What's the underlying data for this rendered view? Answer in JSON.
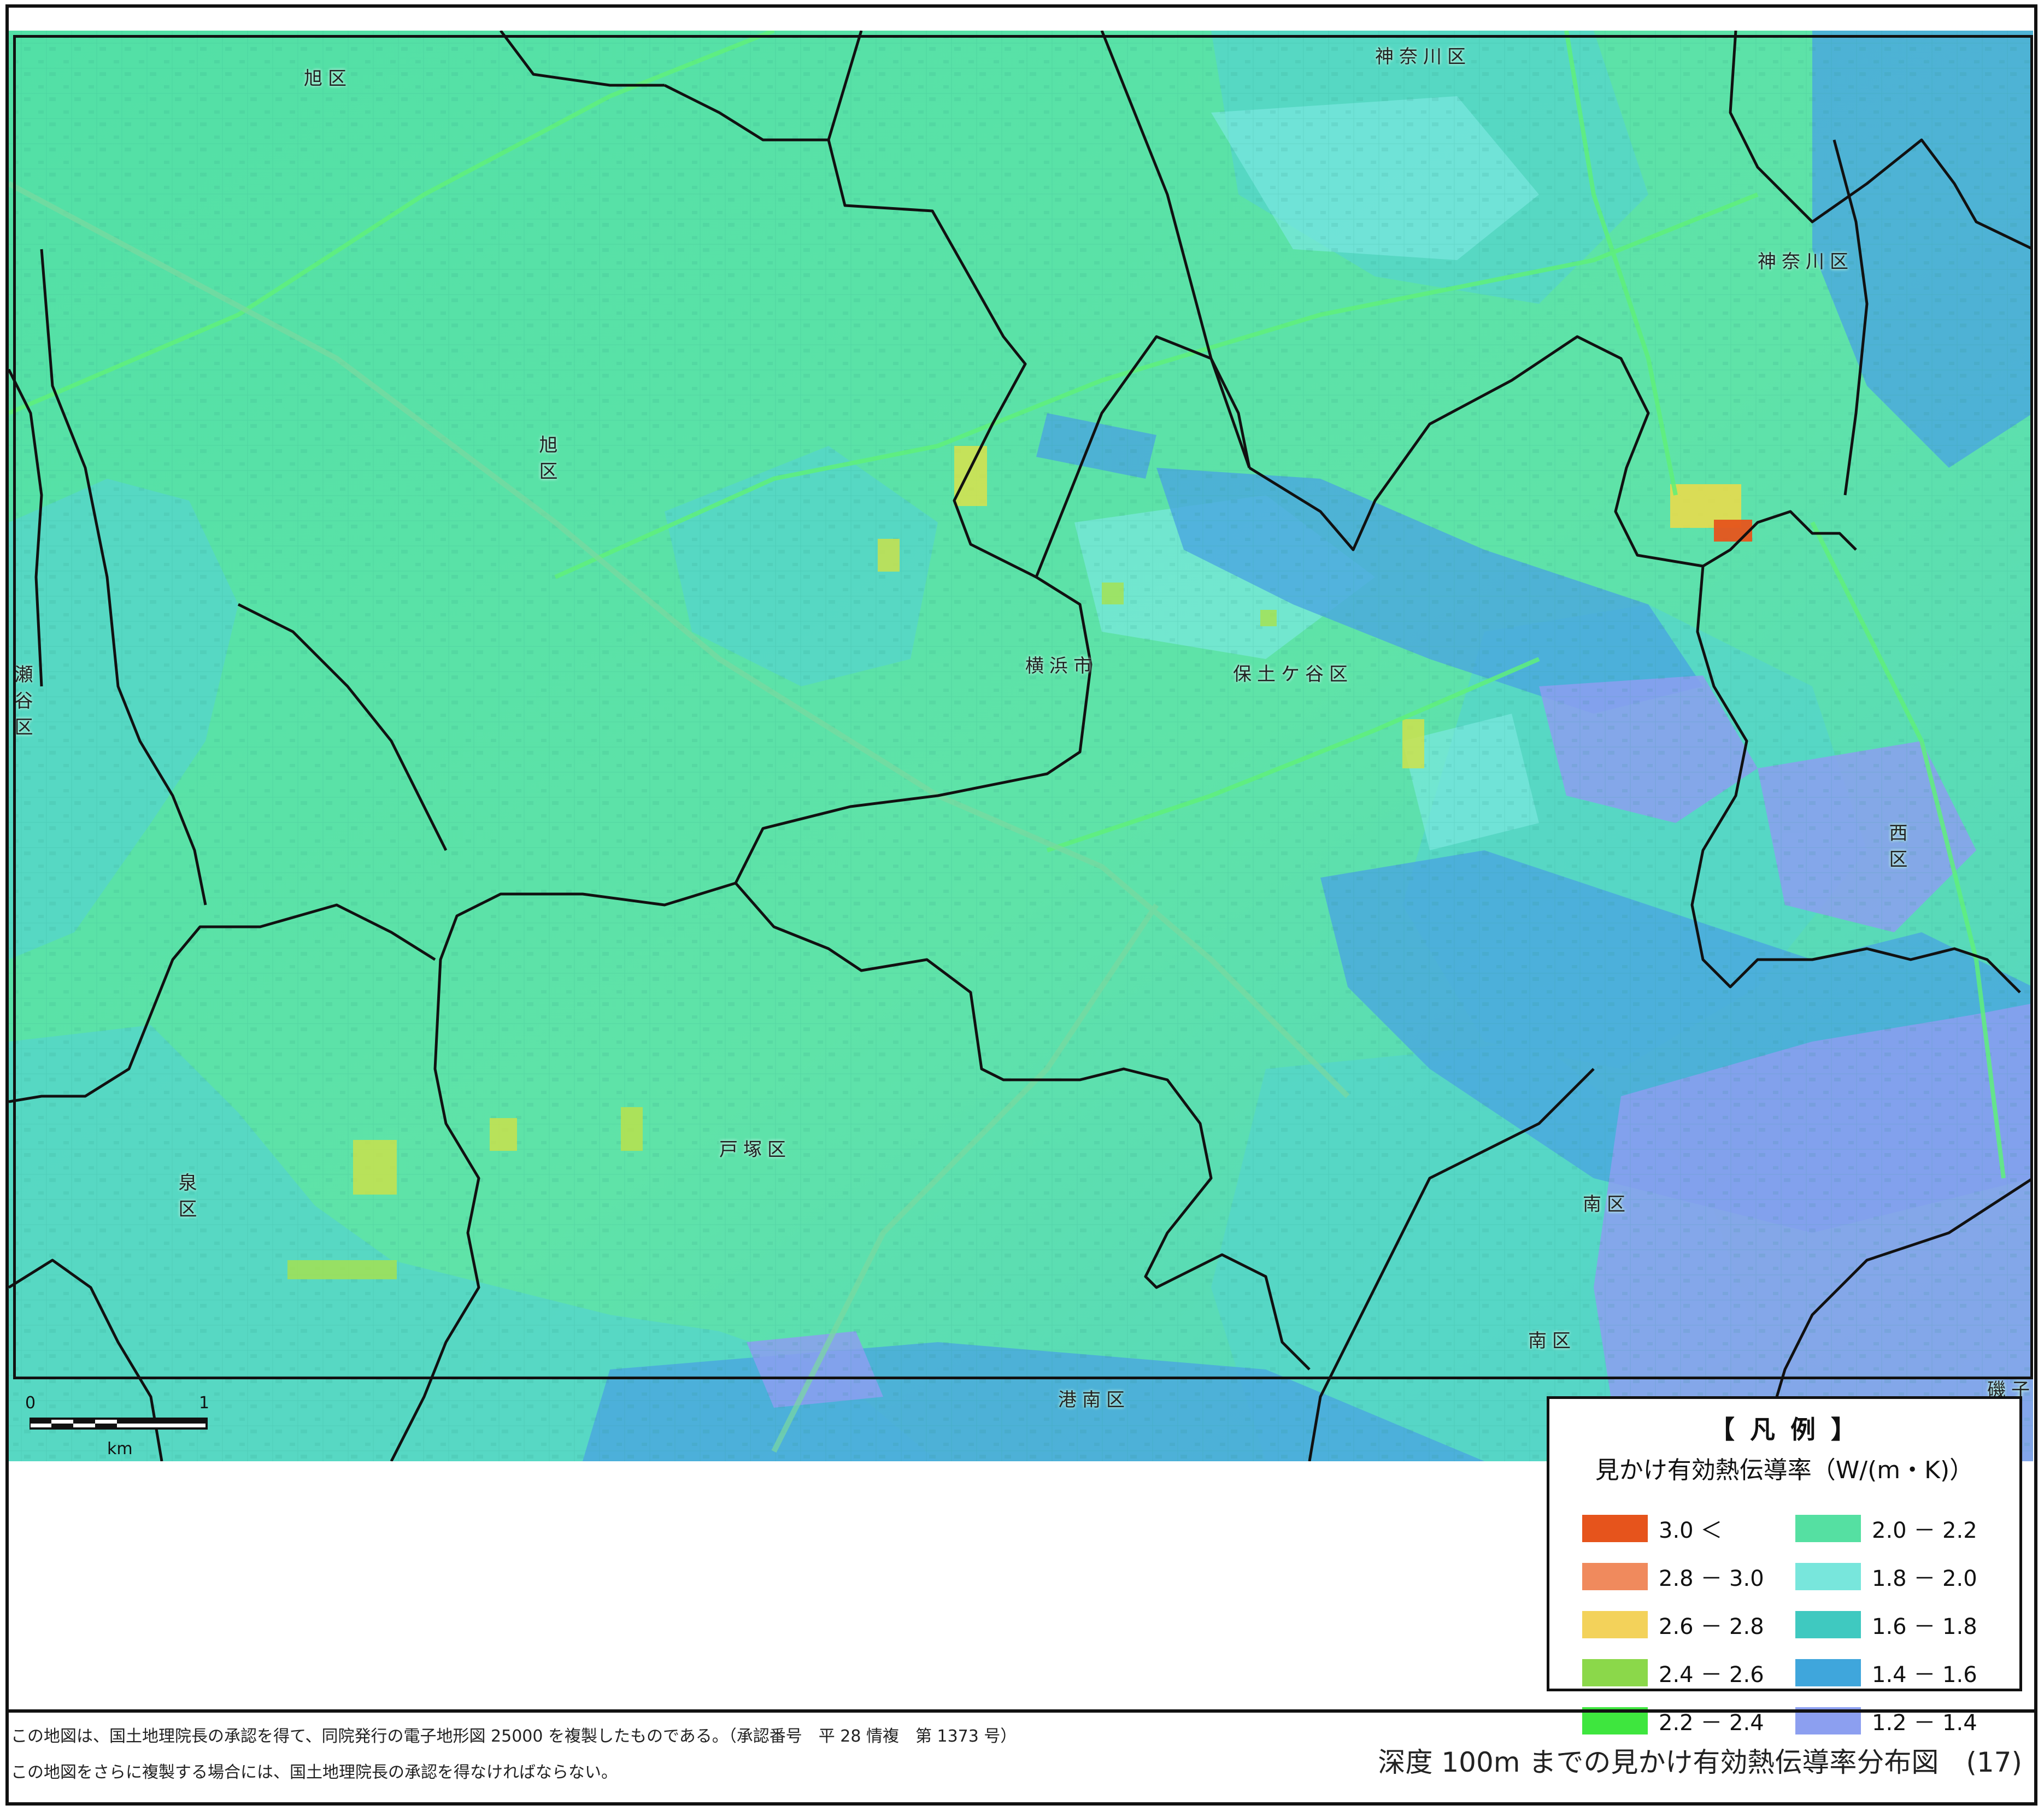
{
  "map": {
    "place_labels": [
      {
        "id": "asahi-ku-top",
        "text": "旭区"
      },
      {
        "id": "asahi-ku-mid",
        "text": "旭区"
      },
      {
        "id": "kanagawa-ku-top",
        "text": "神奈川区"
      },
      {
        "id": "kanagawa-ku-right",
        "text": "神奈川区"
      },
      {
        "id": "yokohama-shi",
        "text": "横浜市"
      },
      {
        "id": "hodogaya-ku",
        "text": "保土ケ谷区"
      },
      {
        "id": "seya-ku",
        "text": "瀬谷区"
      },
      {
        "id": "nishi-ku",
        "text": "西区"
      },
      {
        "id": "izumi-ku",
        "text": "泉区"
      },
      {
        "id": "totsuka-ku",
        "text": "戸塚区"
      },
      {
        "id": "minami-ku-1",
        "text": "南区"
      },
      {
        "id": "minami-ku-2",
        "text": "南区"
      },
      {
        "id": "konan-ku",
        "text": "港南区"
      },
      {
        "id": "isogo-ku",
        "text": "磯子区"
      }
    ],
    "colors": {
      "base_green": "#4fe1a5",
      "teal": "#57d8cc",
      "light_cyan": "#78e6dc",
      "blue": "#4aa6e0",
      "purple_blue": "#8c9ff0",
      "yellow": "#f3d25a",
      "lime": "#8bd84a",
      "orange": "#f08a5d",
      "red": "#e6541c"
    }
  },
  "scale": {
    "label_zero": "0",
    "label_one": "1",
    "unit": "km"
  },
  "legend": {
    "title": "【 凡 例 】",
    "subtitle": "見かけ有効熱伝導率（W/(m・K)）",
    "items": [
      {
        "label": "3.0 ＜",
        "color": "#e6541c"
      },
      {
        "label": "2.0 － 2.2",
        "color": "#55e0a2"
      },
      {
        "label": "2.8 － 3.0",
        "color": "#f08a5d"
      },
      {
        "label": "1.8 － 2.0",
        "color": "#78e6dc"
      },
      {
        "label": "2.6 － 2.8",
        "color": "#f3d25a"
      },
      {
        "label": "1.6 － 1.8",
        "color": "#3fc9c0"
      },
      {
        "label": "2.4 － 2.6",
        "color": "#8bd84a"
      },
      {
        "label": "1.4 － 1.6",
        "color": "#3fa6dc"
      },
      {
        "label": "2.2 － 2.4",
        "color": "#3ee63e"
      },
      {
        "label": "1.2 － 1.4",
        "color": "#8c9ff0"
      }
    ]
  },
  "footer": {
    "note_1": "この地図は、国土地理院長の承認を得て、同院発行の電子地形図 25000 を複製したものである。（承認番号　平 28 情複　第 1373 号）",
    "note_2": "この地図をさらに複製する場合には、国土地理院長の承認を得なければならない。",
    "figure_title": "深度 100m までの見かけ有効熱伝導率分布図　(17)"
  }
}
